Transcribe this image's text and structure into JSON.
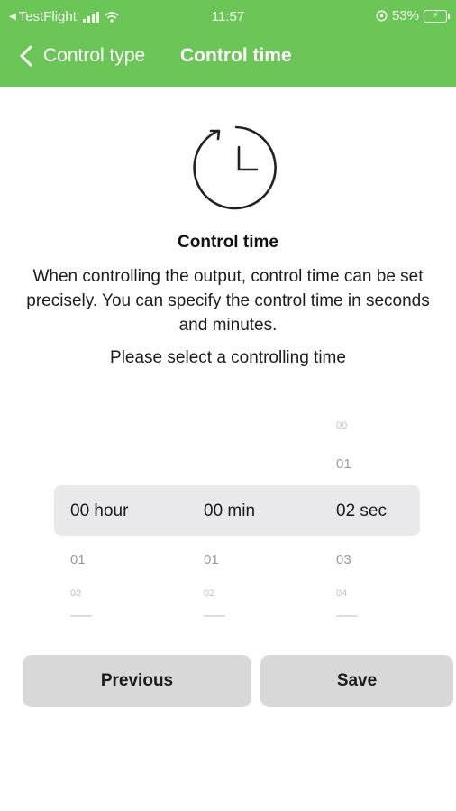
{
  "status_bar": {
    "back_app": "TestFlight",
    "time": "11:57",
    "battery_percent": "53%"
  },
  "nav": {
    "back_label": "Control type",
    "title": "Control time"
  },
  "content": {
    "icon": "clock-icon",
    "title": "Control time",
    "description": "When controlling the output, control time can be set precisely. You can specify the control time in seconds and minutes.",
    "prompt": "Please select a controlling time"
  },
  "picker": {
    "hours": {
      "selected": "00 hour",
      "next": "01",
      "next2": "02"
    },
    "minutes": {
      "selected": "00 min",
      "next": "01",
      "next2": "02"
    },
    "seconds": {
      "prev2": "00",
      "prev": "01",
      "selected": "02 sec",
      "next": "03",
      "next2": "04"
    }
  },
  "buttons": {
    "previous": "Previous",
    "save": "Save"
  },
  "colors": {
    "header": "#6cc557",
    "button": "#d8d8d8",
    "picker_highlight": "#e9e9eb"
  }
}
